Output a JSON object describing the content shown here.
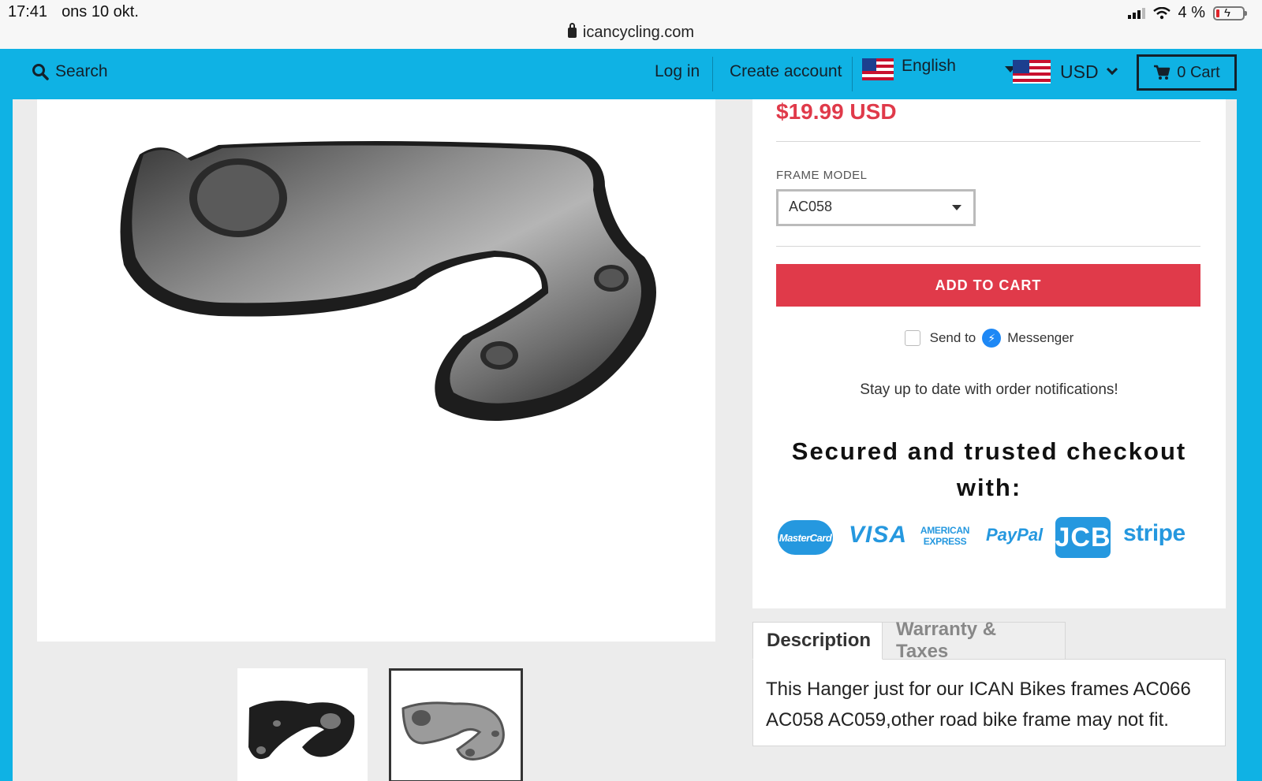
{
  "status_bar": {
    "time": "17:41",
    "date": "ons 10 okt.",
    "url": "icancycling.com",
    "battery": "4 %"
  },
  "nav": {
    "search": "Search",
    "login": "Log in",
    "create_account": "Create account",
    "language": "English",
    "currency": "USD",
    "cart": "0 Cart"
  },
  "product": {
    "price": "$19.99 USD",
    "frame_model_label": "FRAME MODEL",
    "frame_model_value": "AC058",
    "add_to_cart": "ADD TO CART",
    "messenger": {
      "send_to": "Send to",
      "name": "Messenger"
    },
    "notifications": "Stay up to date with order notifications!",
    "secured_line1": "Secured and trusted checkout",
    "secured_line2": "with:",
    "payment_methods": [
      "MasterCard",
      "VISA",
      "AMERICAN EXPRESS",
      "PayPal",
      "JCB",
      "stripe"
    ]
  },
  "tabs": {
    "description": "Description",
    "warranty": "Warranty & Taxes"
  },
  "description_text": "This Hanger just for our ICAN Bikes frames AC066 AC058 AC059,other road bike frame may not fit.",
  "colors": {
    "nav_blue": "#0fb2e4",
    "accent_red": "#e03a4a",
    "payment_blue": "#2598df"
  }
}
